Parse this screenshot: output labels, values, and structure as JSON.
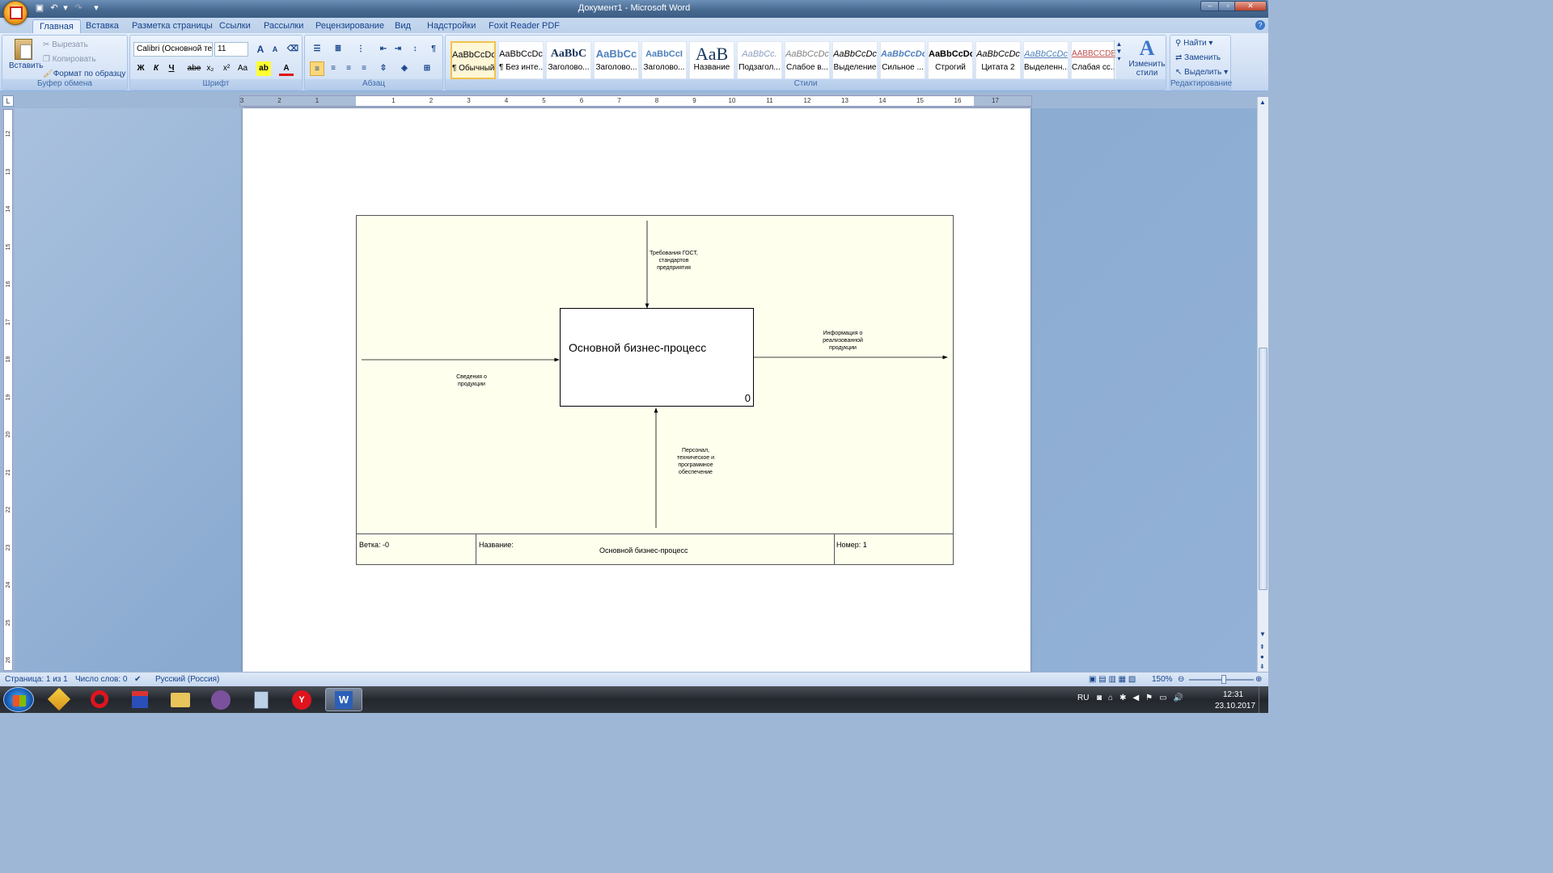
{
  "window": {
    "title": "Документ1 - Microsoft Word"
  },
  "tabs": [
    "Главная",
    "Вставка",
    "Разметка страницы",
    "Ссылки",
    "Рассылки",
    "Рецензирование",
    "Вид",
    "Надстройки",
    "Foxit Reader PDF"
  ],
  "ribbon": {
    "clipboard": {
      "paste": "Вставить",
      "cut": "Вырезать",
      "copy": "Копировать",
      "format_painter": "Формат по образцу",
      "label": "Буфер обмена"
    },
    "font": {
      "name": "Calibri (Основной те",
      "size": "11",
      "label": "Шрифт",
      "bold": "Ж",
      "italic": "К",
      "underline": "Ч",
      "strike": "abe",
      "sub": "x₂",
      "sup": "x²",
      "case": "Aa",
      "grow": "A",
      "shrink": "A"
    },
    "paragraph": {
      "label": "Абзац",
      "pilcrow": "¶"
    },
    "styles": {
      "label": "Стили",
      "change": "Изменить стили",
      "items": [
        {
          "preview": "AaBbCcDc",
          "name": "¶ Обычный"
        },
        {
          "preview": "AaBbCcDc",
          "name": "¶ Без инте..."
        },
        {
          "preview": "AaBbC",
          "name": "Заголово..."
        },
        {
          "preview": "AaBbCc",
          "name": "Заголово..."
        },
        {
          "preview": "AaBbCcI",
          "name": "Заголово..."
        },
        {
          "preview": "AaB",
          "name": "Название"
        },
        {
          "preview": "AaBbCc.",
          "name": "Подзагол..."
        },
        {
          "preview": "AaBbCcDc",
          "name": "Слабое в..."
        },
        {
          "preview": "AaBbCcDc",
          "name": "Выделение"
        },
        {
          "preview": "AaBbCcDc",
          "name": "Сильное ..."
        },
        {
          "preview": "AaBbCcDc",
          "name": "Строгий"
        },
        {
          "preview": "AaBbCcDc",
          "name": "Цитата 2"
        },
        {
          "preview": "AaBbCcDc",
          "name": "Выделенн..."
        },
        {
          "preview": "AABBCCDE",
          "name": "Слабая сс..."
        }
      ]
    },
    "editing": {
      "label": "Редактирование",
      "find": "Найти",
      "replace": "Заменить",
      "select": "Выделить"
    }
  },
  "ruler": {
    "h_numbers": [
      "3",
      "2",
      "1",
      "1",
      "2",
      "3",
      "4",
      "5",
      "6",
      "7",
      "8",
      "9",
      "10",
      "11",
      "12",
      "13",
      "14",
      "15",
      "16",
      "17"
    ],
    "v_numbers": [
      "12",
      "13",
      "14",
      "15",
      "16",
      "17",
      "18",
      "19",
      "20",
      "21",
      "22",
      "23",
      "24",
      "25",
      "26"
    ]
  },
  "diagram": {
    "box_title": "Основной бизнес-процесс",
    "box_number": "0",
    "control": "Требования ГОСТ, стандартов предприятия",
    "input": "Сведения о продукции",
    "output": "Информация о реализованной продукции",
    "mechanism": "Персонал, техническое и программное обеспечение",
    "footer": {
      "branch": "Ветка: -0",
      "name_label": "Название:",
      "name_value": "Основной бизнес-процесс",
      "number": "Номер: 1"
    }
  },
  "status": {
    "page": "Страница: 1 из 1",
    "words": "Число слов: 0",
    "language": "Русский (Россия)",
    "zoom": "150%"
  },
  "taskbar": {
    "lang": "RU",
    "time": "12:31",
    "date": "23.10.2017"
  }
}
